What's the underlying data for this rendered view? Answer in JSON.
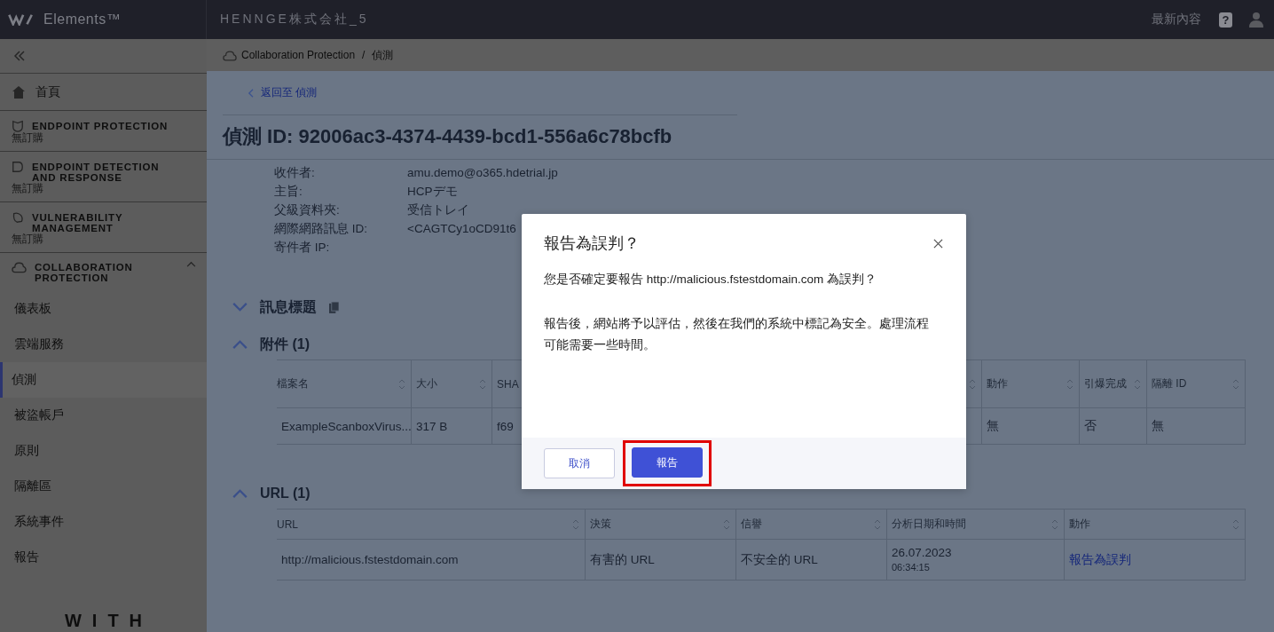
{
  "topbar": {
    "logo_text": "Elements™",
    "tenant": "HENNGE株式会社_5",
    "whats_new": "最新內容",
    "help_glyph": "?"
  },
  "sidebar": {
    "home": "首頁",
    "products": [
      {
        "label": "ENDPOINT PROTECTION",
        "status": "無訂購"
      },
      {
        "label": "ENDPOINT DETECTION AND RESPONSE",
        "status": "無訂購"
      },
      {
        "label": "VULNERABILITY MANAGEMENT",
        "status": "無訂購"
      }
    ],
    "section": {
      "label": "COLLABORATION PROTECTION",
      "expanded": true,
      "items": [
        {
          "label": "儀表板",
          "selected": false
        },
        {
          "label": "雲端服務",
          "selected": false
        },
        {
          "label": "偵測",
          "selected": true
        },
        {
          "label": "被盜帳戶",
          "selected": false
        },
        {
          "label": "原則",
          "selected": false
        },
        {
          "label": "隔離區",
          "selected": false
        },
        {
          "label": "系統事件",
          "selected": false
        },
        {
          "label": "報告",
          "selected": false
        }
      ]
    },
    "footer_logo": "WITH"
  },
  "breadcrumb": {
    "separator": "/",
    "items": [
      "Collaboration Protection",
      "偵測"
    ]
  },
  "back_link": "返回至 偵測",
  "title": "偵測 ID: 92006ac3-4374-4439-bcd1-556a6c78bcfb",
  "fields": [
    {
      "label": "收件者:",
      "value": "amu.demo@o365.hdetrial.jp"
    },
    {
      "label": "主旨:",
      "value": "HCPデモ"
    },
    {
      "label": "父級資料夾:",
      "value": "受信トレイ"
    },
    {
      "label": "網際網路訊息 ID:",
      "value": "<CAGTCy1oCD91t6"
    },
    {
      "label": "寄件者 IP:"
    }
  ],
  "sections": [
    {
      "kind": "header",
      "title": "訊息標題",
      "expanded": false
    },
    {
      "kind": "table",
      "title": "附件 (1)",
      "expanded": true,
      "columns": [
        "檔案名",
        "大小",
        "SHA",
        "動作",
        "引爆完成",
        "隔離 ID"
      ],
      "rows": [
        [
          {
            "kind": "text",
            "text": "ExampleScanboxVirus..."
          },
          {
            "kind": "text",
            "text": "317 B"
          },
          {
            "kind": "text",
            "text": "f69"
          },
          {
            "kind": "text",
            "text": "無"
          },
          {
            "kind": "text",
            "text": "否"
          },
          {
            "kind": "text",
            "text": "無"
          }
        ]
      ]
    },
    {
      "kind": "table",
      "title": "URL (1)",
      "expanded": true,
      "columns": [
        "URL",
        "決策",
        "信譽",
        "分析日期和時間",
        "動作"
      ],
      "rows": [
        [
          {
            "kind": "text",
            "text": "http://malicious.fstestdomain.com"
          },
          {
            "kind": "text",
            "text": "有害的 URL"
          },
          {
            "kind": "text",
            "text": "不安全的 URL"
          },
          {
            "kind": "datetime",
            "text": "26.07.2023",
            "sub": "06:34:15"
          },
          {
            "kind": "link",
            "text": "報告為誤判"
          }
        ]
      ]
    }
  ],
  "modal": {
    "title": "報告為誤判？",
    "question": "您是否確定要報告 http://malicious.fstestdomain.com 為誤判？",
    "note": "報告後，網站將予以評估，然後在我們的系統中標記為安全。處理流程可能需要一些時間。",
    "buttons": [
      {
        "label": "取消",
        "kind": "secondary",
        "highlighted": false
      },
      {
        "label": "報告",
        "kind": "primary",
        "highlighted": true
      }
    ]
  }
}
